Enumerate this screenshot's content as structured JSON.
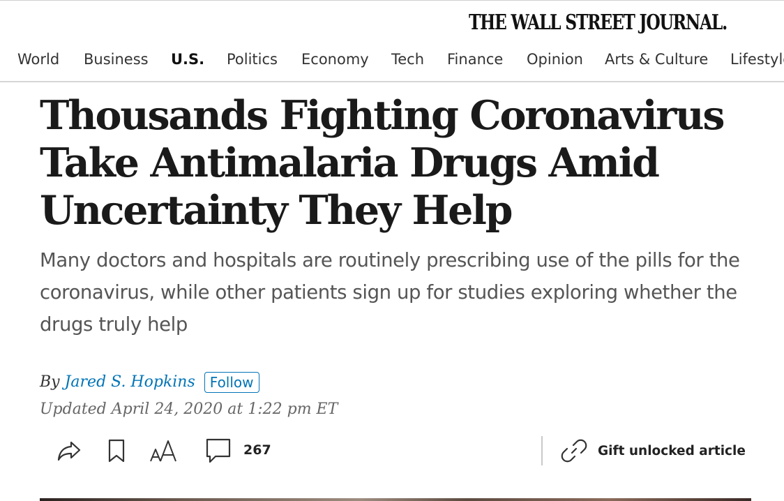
{
  "masthead": {
    "logo_text": "THE WALL STREET JOURNAL."
  },
  "nav": {
    "items": [
      {
        "label": "World"
      },
      {
        "label": "Business"
      },
      {
        "label": "U.S.",
        "active": true
      },
      {
        "label": "Politics"
      },
      {
        "label": "Economy"
      },
      {
        "label": "Tech"
      },
      {
        "label": "Finance"
      },
      {
        "label": "Opinion"
      },
      {
        "label": "Arts & Culture"
      },
      {
        "label": "Lifestyle"
      }
    ]
  },
  "article": {
    "headline": "Thousands Fighting Coronavirus Take Antimalaria Drugs Amid Uncertainty They Help",
    "dek": "Many doctors and hospitals are routinely prescribing use of the pills for the coronavirus, while other patients sign up for studies exploring whether the drugs truly help",
    "byline_prefix": "By",
    "author": "Jared S. Hopkins",
    "follow_label": "Follow",
    "updated": "Updated April 24, 2020 at 1:22 pm ET"
  },
  "toolbar": {
    "share_icon": "share-icon",
    "bookmark_icon": "bookmark-icon",
    "text_size_icon": "text-size-icon",
    "comments_icon": "comment-icon",
    "comments_count": "267",
    "gift_icon": "link-icon",
    "gift_label": "Gift unlocked article"
  },
  "colors": {
    "link_blue": "#0274b6",
    "text": "#222222",
    "dek_gray": "#555555"
  }
}
